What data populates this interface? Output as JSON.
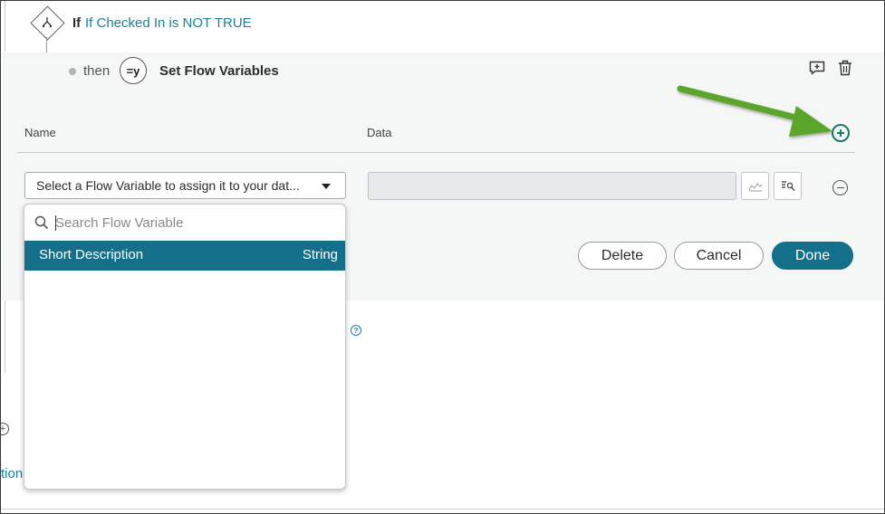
{
  "condition": {
    "keyword": "If",
    "text": "If Checked In is NOT TRUE"
  },
  "action": {
    "then_label": "then",
    "badge": "=y",
    "title": "Set Flow Variables"
  },
  "columns": {
    "name": "Name",
    "data": "Data"
  },
  "variable_select": {
    "value": "Select a Flow Variable to assign it to your dat..."
  },
  "dropdown": {
    "search_placeholder": "Search Flow Variable",
    "items": [
      {
        "name": "Short Description",
        "type": "String"
      }
    ]
  },
  "buttons": {
    "delete": "Delete",
    "cancel": "Cancel",
    "done": "Done"
  },
  "background": {
    "partial_link": "tion",
    "help_glyph": "?",
    "plus_glyph": "+"
  },
  "colors": {
    "accent": "#14708a",
    "link": "#1b7f99",
    "panel": "#f5f6f6",
    "annotation_arrow": "#5aa52a"
  }
}
